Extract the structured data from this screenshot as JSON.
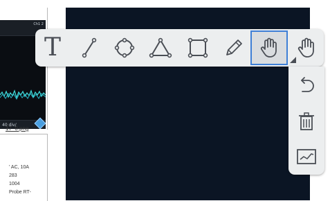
{
  "document": {
    "scope_header_text": "Ch1 2",
    "scope_footer_text": "40 div/",
    "filename": "17_0.png",
    "spec_lines": [
      "' AC, 10A",
      "283",
      "1004",
      "Probe RT-"
    ]
  },
  "toolbar": {
    "text_tool_label": "T",
    "tools": [
      {
        "name": "text",
        "icon": "text-icon",
        "active": false
      },
      {
        "name": "line",
        "icon": "line-icon",
        "active": false
      },
      {
        "name": "circle",
        "icon": "circle-icon",
        "active": false
      },
      {
        "name": "triangle",
        "icon": "triangle-icon",
        "active": false
      },
      {
        "name": "rectangle",
        "icon": "rectangle-icon",
        "active": false
      },
      {
        "name": "pencil",
        "icon": "pencil-icon",
        "active": false
      },
      {
        "name": "pan",
        "icon": "hand-icon",
        "active": true
      },
      {
        "name": "pan-alt",
        "icon": "hand-icon",
        "active": false
      }
    ]
  },
  "side_panel": {
    "tools": [
      {
        "name": "undo",
        "icon": "undo-icon"
      },
      {
        "name": "delete",
        "icon": "trash-icon"
      },
      {
        "name": "chart",
        "icon": "chart-icon"
      }
    ]
  },
  "colors": {
    "canvas": "#0b1524",
    "toolbar": "#eceeef",
    "active_border": "#3e7fd6",
    "icon": "#4a4e55",
    "trace": "#3fd6d6"
  }
}
